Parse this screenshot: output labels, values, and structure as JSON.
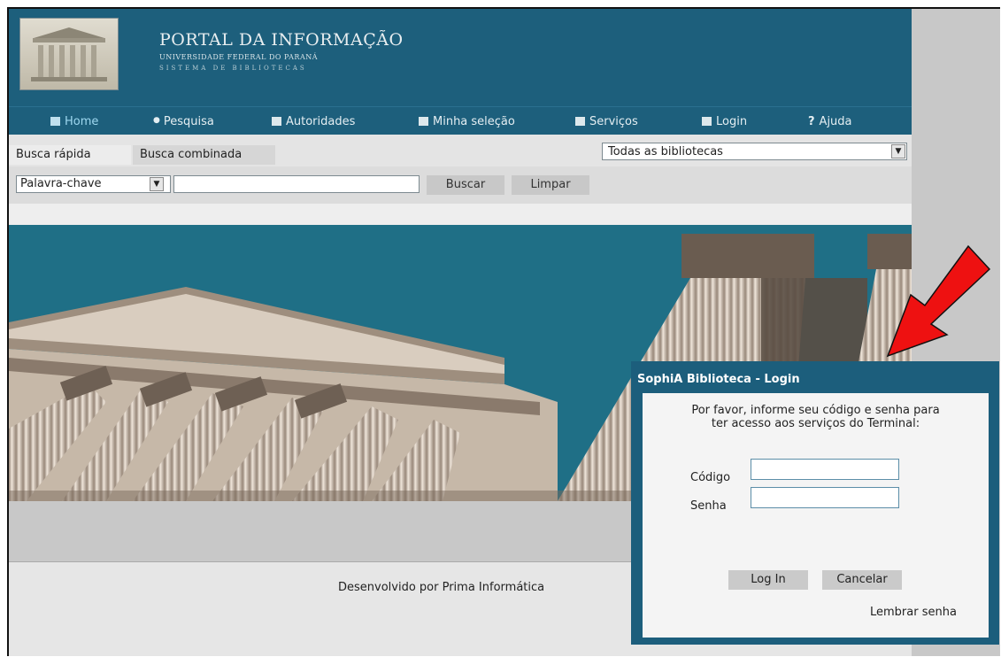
{
  "brand": {
    "title": "PORTAL DA INFORMAÇÃO",
    "subtitle": "UNIVERSIDADE FEDERAL DO PARANÁ",
    "subtitle2": "SISTEMA DE BIBLIOTECAS"
  },
  "nav": {
    "items": [
      {
        "label": "Home",
        "icon": "home-icon"
      },
      {
        "label": "Pesquisa",
        "icon": "search-dot-icon"
      },
      {
        "label": "Autoridades",
        "icon": "authorities-icon"
      },
      {
        "label": "Minha seleção",
        "icon": "grid-icon"
      },
      {
        "label": "Serviços",
        "icon": "services-icon"
      },
      {
        "label": "Login",
        "icon": "login-icon"
      },
      {
        "label": "Ajuda",
        "icon": "help-icon"
      }
    ]
  },
  "tabs": {
    "quick": "Busca rápida",
    "combined": "Busca combinada"
  },
  "library_select": {
    "value": "Todas as bibliotecas"
  },
  "search": {
    "field_select": "Palavra-chave",
    "query": "",
    "search_button": "Buscar",
    "clear_button": "Limpar"
  },
  "footer": {
    "text": "Desenvolvido por Prima Informática"
  },
  "login_dialog": {
    "title": "SophiA Biblioteca - Login",
    "message_line1": "Por favor, informe seu código e senha para",
    "message_line2": "ter acesso aos serviços do Terminal:",
    "code_label": "Código",
    "password_label": "Senha",
    "login_button": "Log In",
    "cancel_button": "Cancelar",
    "remember_link": "Lembrar senha"
  },
  "colors": {
    "header": "#1d5f7c",
    "banner_sky": "#1f6f86",
    "arrow": "#ee1111"
  }
}
